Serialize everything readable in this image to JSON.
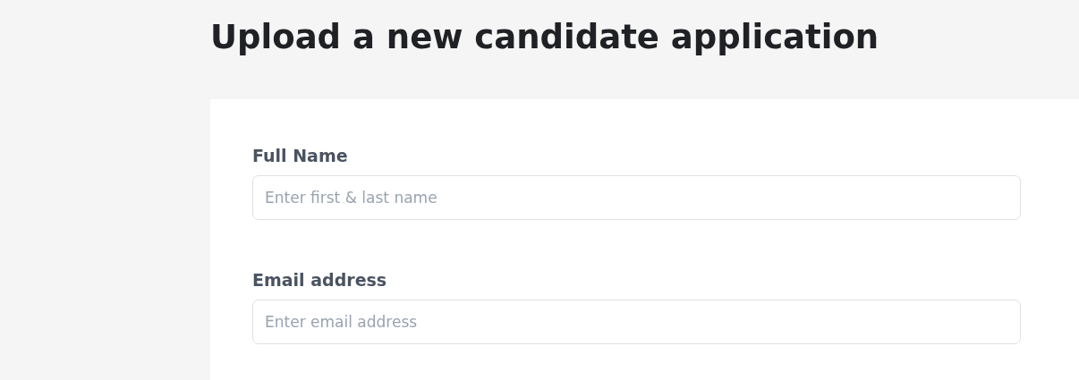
{
  "title": "Upload a new candidate application",
  "fields": [
    {
      "label": "Full Name",
      "placeholder": "Enter first & last name"
    },
    {
      "label": "Email address",
      "placeholder": "Enter email address"
    }
  ]
}
